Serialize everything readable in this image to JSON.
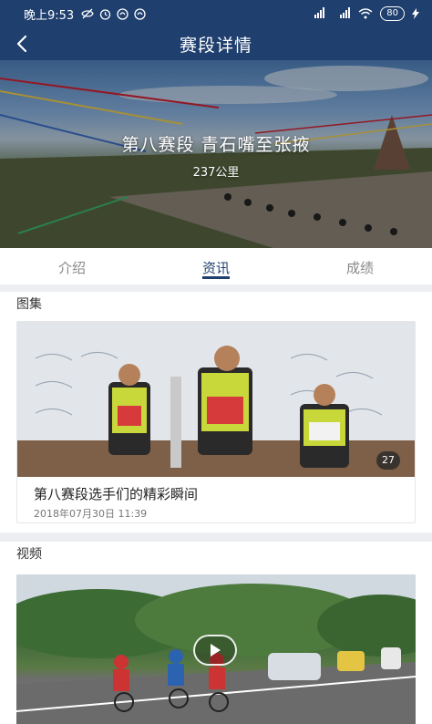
{
  "status_bar": {
    "time": "晚上9:53",
    "signal_1": "4G",
    "signal_2": "4G",
    "battery": "80"
  },
  "nav": {
    "title": "赛段详情",
    "back_icon": "chevron-left-icon"
  },
  "hero": {
    "title": "第八赛段 青石嘴至张掖",
    "distance": "237公里"
  },
  "tabs": [
    {
      "label": "介绍",
      "active": false
    },
    {
      "label": "资讯",
      "active": true
    },
    {
      "label": "成绩",
      "active": false
    }
  ],
  "gallery": {
    "heading": "图集",
    "card": {
      "title": "第八赛段选手们的精彩瞬间",
      "date": "2018年07月30日  11:39",
      "count": "27"
    }
  },
  "video": {
    "heading": "视频"
  },
  "colors": {
    "primary": "#1f3f6e",
    "background": "#f2f3f5"
  }
}
